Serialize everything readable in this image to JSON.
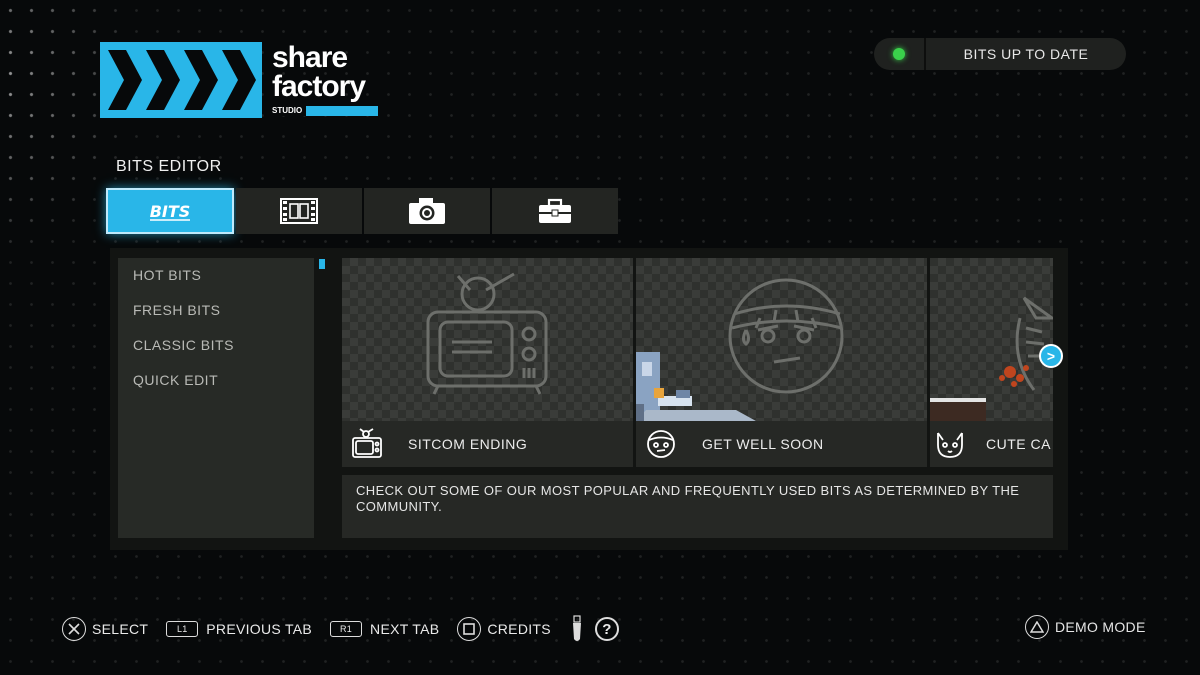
{
  "app": {
    "logo_line1": "share",
    "logo_line2": "factory",
    "logo_sub": "STUDIO",
    "brand_color": "#29b6e8"
  },
  "status": {
    "text": "BITS UP TO DATE",
    "indicator_color": "#3ad14b"
  },
  "section_title": "BITS EDITOR",
  "tabs": [
    {
      "icon": "bits-logo-icon",
      "label": "BITS",
      "active": true
    },
    {
      "icon": "film-strip-icon",
      "active": false
    },
    {
      "icon": "camera-icon",
      "active": false
    },
    {
      "icon": "toolbox-icon",
      "active": false
    }
  ],
  "sidebar": {
    "items": [
      {
        "label": "HOT BITS"
      },
      {
        "label": "FRESH BITS"
      },
      {
        "label": "CLASSIC BITS"
      },
      {
        "label": "QUICK EDIT"
      }
    ]
  },
  "cards": [
    {
      "title": "SITCOM ENDING",
      "icon": "tv-icon"
    },
    {
      "title": "GET WELL SOON",
      "icon": "bandaged-face-icon"
    },
    {
      "title": "CUTE CA",
      "icon": "cat-icon"
    }
  ],
  "next_arrow": ">",
  "description": "CHECK OUT SOME OF OUR MOST POPULAR AND FREQUENTLY USED BITS AS DETERMINED BY THE COMMUNITY.",
  "footer": {
    "select": "SELECT",
    "l1": "L1",
    "previous_tab": "PREVIOUS TAB",
    "r1": "R1",
    "next_tab": "NEXT TAB",
    "credits": "CREDITS",
    "help": "?",
    "demo_mode": "DEMO MODE"
  }
}
